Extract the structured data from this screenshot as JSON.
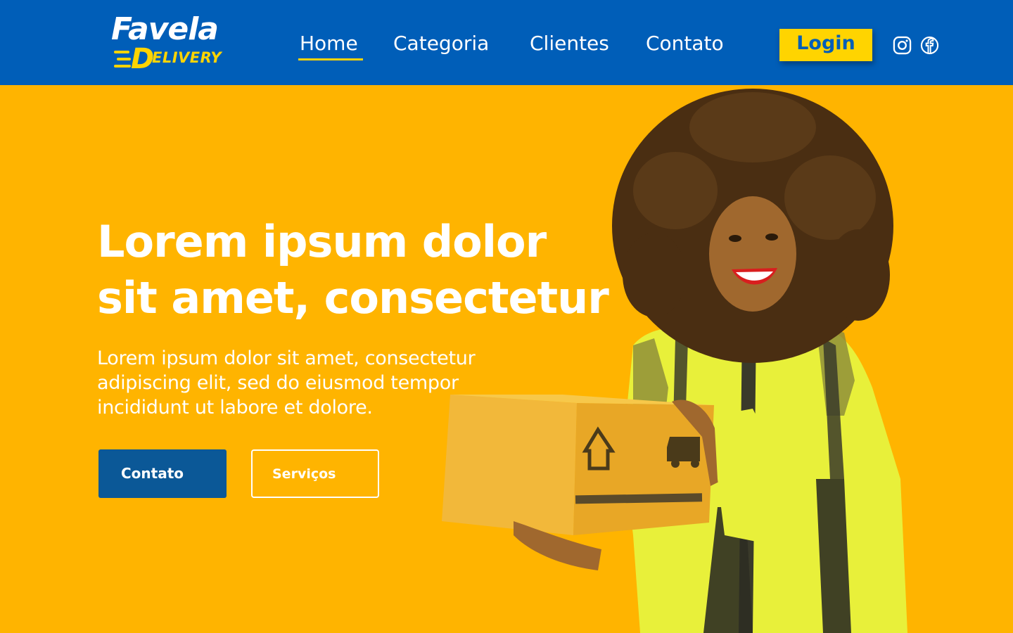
{
  "brand": {
    "logo_top": "Favela",
    "logo_d": "D",
    "logo_bottom": "ELIVERY"
  },
  "nav": {
    "items": [
      {
        "label": "Home",
        "active": true
      },
      {
        "label": "Categoria",
        "active": false
      },
      {
        "label": "Clientes",
        "active": false
      },
      {
        "label": "Contato",
        "active": false
      }
    ],
    "login_label": "Login",
    "social_icons": [
      "instagram-icon",
      "facebook-icon"
    ]
  },
  "hero": {
    "title_lines": [
      "Lorem ipsum dolor",
      "sit amet, consectetur"
    ],
    "text_lines": [
      "Lorem ipsum dolor sit amet, consectetur",
      "adipiscing elit, sed do eiusmod tempor",
      "incididunt ut labore et dolore."
    ],
    "primary_button": "Contato",
    "secondary_button": "Serviços"
  },
  "colors": {
    "nav_bg": "#005EB8",
    "hero_bg": "#FFB400",
    "accent_yellow": "#FFD400",
    "primary_button": "#0B5897"
  }
}
